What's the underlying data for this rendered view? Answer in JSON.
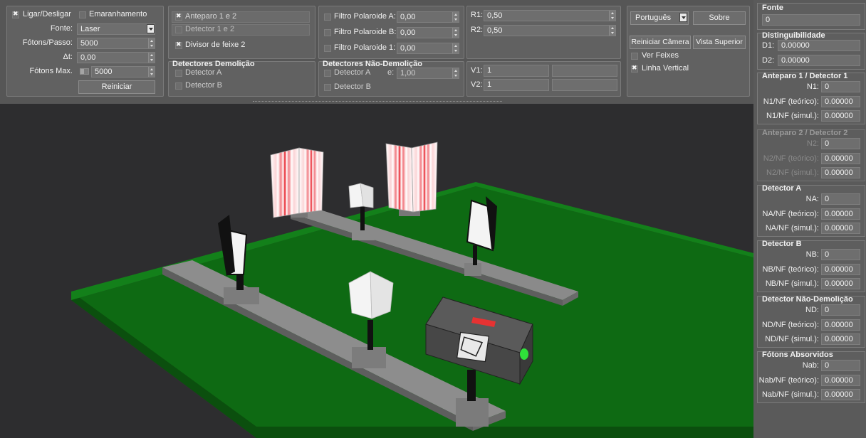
{
  "source": {
    "power_label": "Ligar/Desligar",
    "entanglement_label": "Emaranhamento",
    "fonte_label": "Fonte:",
    "fonte_value": "Laser",
    "fotons_passo_label": "Fótons/Passo:",
    "fotons_passo_value": "5000",
    "dt_label": "Δt:",
    "dt_value": "0,00",
    "fotons_max_label": "Fótons Max.",
    "fotons_max_value": "5000",
    "reset_label": "Reiniciar"
  },
  "elements": {
    "item1": "Anteparo 1 e 2",
    "item2": "Detector 1 e 2",
    "item3": "Divisor de feixe 2"
  },
  "demolition": {
    "title": "Detectores Demolição",
    "det_a": "Detector A",
    "det_b": "Detector B"
  },
  "polaroid": {
    "a_label": "Filtro Polaroide A:",
    "a_value": "0,00",
    "b_label": "Filtro Polaroide B:",
    "b_value": "0,00",
    "one_label": "Filtro Polaroide 1:",
    "one_value": "0,00"
  },
  "nondemolition": {
    "title": "Detectores Não-Demolição",
    "det_a": "Detector A",
    "e_label": "e:",
    "e_value": "1,00",
    "det_b": "Detector B"
  },
  "ratios": {
    "r1_label": "R1:",
    "r1_value": "0,50",
    "r2_label": "R2:",
    "r2_value": "0,50",
    "v1_label": "V1:",
    "v1_value": "1",
    "v2_label": "V2:",
    "v2_value": "1"
  },
  "view": {
    "language": "Português",
    "about": "Sobre",
    "reset_camera": "Reiniciar Câmera",
    "top_view": "Vista Superior",
    "show_beams": "Ver Feixes",
    "vertical_line": "Linha Vertical"
  },
  "sidebar": {
    "fonte_title": "Fonte",
    "fonte_value": "0",
    "dist_title": "Distinguibilidade",
    "d1_label": "D1:",
    "d1_value": "0.00000",
    "d2_label": "D2:",
    "d2_value": "0.00000",
    "s1_title": "Anteparo 1 / Detector 1",
    "n1_label": "N1:",
    "n1_value": "0",
    "n1_teo_label": "N1/NF (teórico):",
    "n1_teo_value": "0.00000",
    "n1_sim_label": "N1/NF (simul.):",
    "n1_sim_value": "0.00000",
    "s2_title": "Anteparo 2 / Detector 2",
    "n2_label": "N2:",
    "n2_value": "0",
    "n2_teo_label": "N2/NF (teórico):",
    "n2_teo_value": "0.00000",
    "n2_sim_label": "N2/NF (simul.):",
    "n2_sim_value": "0.00000",
    "sa_title": "Detector A",
    "na_label": "NA:",
    "na_value": "0",
    "na_teo_label": "NA/NF (teórico):",
    "na_teo_value": "0.00000",
    "na_sim_label": "NA/NF (simul.):",
    "na_sim_value": "0.00000",
    "sb_title": "Detector B",
    "nb_label": "NB:",
    "nb_value": "0",
    "nb_teo_label": "NB/NF (teórico):",
    "nb_teo_value": "0.00000",
    "nb_sim_label": "NB/NF (simul.):",
    "nb_sim_value": "0.00000",
    "snd_title": "Detector Não-Demolição",
    "nd_label": "ND:",
    "nd_value": "0",
    "nd_teo_label": "ND/NF (teórico):",
    "nd_teo_value": "0.00000",
    "nd_sim_label": "ND/NF (simul.):",
    "nd_sim_value": "0.00000",
    "sab_title": "Fótons Absorvidos",
    "nab_label": "Nab:",
    "nab_value": "0",
    "nab_teo_label": "Nab/NF (teórico):",
    "nab_teo_value": "0.00000",
    "nab_sim_label": "Nab/NF (simul.):",
    "nab_sim_value": "0.00000"
  },
  "colors": {
    "table_green": "#0e6a13",
    "viewport_bg": "#2d2d2f",
    "fringe_red": "#e8202a",
    "led_green": "#2fe03a",
    "button_red": "#e63232"
  }
}
